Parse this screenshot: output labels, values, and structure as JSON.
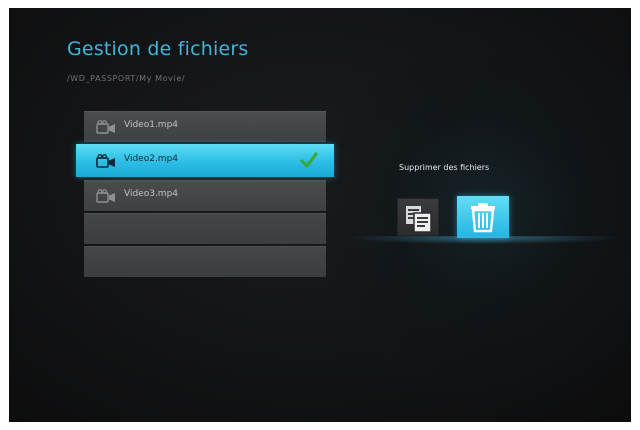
{
  "header": {
    "title": "Gestion de fichiers",
    "path": "/WD_PASSPORT/My Movie/"
  },
  "file_list": {
    "items": [
      {
        "label": "Video1.mp4",
        "icon": "video-camera-icon",
        "selected": false
      },
      {
        "label": "Video2.mp4",
        "icon": "video-camera-icon",
        "selected": true,
        "checked": true
      },
      {
        "label": "Video3.mp4",
        "icon": "video-camera-icon",
        "selected": false
      },
      {
        "label": "",
        "empty": true
      },
      {
        "label": "",
        "empty": true
      }
    ]
  },
  "actions": {
    "label": "Supprimer des fichiers",
    "buttons": [
      {
        "name": "copy-files",
        "icon": "copy-icon",
        "focused": false
      },
      {
        "name": "delete-files",
        "icon": "trash-icon",
        "focused": true
      }
    ]
  },
  "colors": {
    "accent": "#3fb6da",
    "selection": "#2fc0e6",
    "check": "#3aa83a",
    "row": "#444547",
    "background": "#121314"
  }
}
